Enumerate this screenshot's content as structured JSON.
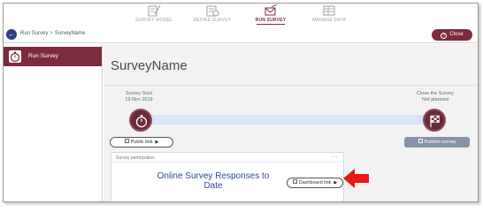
{
  "topnav": {
    "items": [
      {
        "label": "SURVEY MODEL",
        "icon": "edit-form-icon",
        "active": false
      },
      {
        "label": "DEFINE SURVEY",
        "icon": "settings-form-icon",
        "active": false
      },
      {
        "label": "RUN SURVEY",
        "icon": "send-envelope-icon",
        "active": true
      },
      {
        "label": "MANAGE DATA",
        "icon": "data-table-icon",
        "active": false
      }
    ]
  },
  "breadcrumb": {
    "items": [
      "Run Survey",
      "SurveyName"
    ],
    "separator": ">"
  },
  "close_button": {
    "label": "Close"
  },
  "sidebar": {
    "items": [
      {
        "label": "Run Survey",
        "icon": "stopwatch-icon",
        "active": true
      }
    ]
  },
  "main": {
    "title": "SurveyName",
    "survey_start": {
      "label": "Survey Start",
      "date": "19 Nov 2019"
    },
    "survey_close": {
      "label": "Close the Survey",
      "status": "Not planned"
    },
    "public_link_label": "Public link",
    "publish_label": "Publish survey",
    "participation_card": {
      "title": "Survey participation",
      "more": "...",
      "heading": "Online Survey Responses to Date",
      "dashboard_link_label": "Dashboard link"
    }
  },
  "colors": {
    "brand": "#7b2b3b",
    "timeline": "#d7e6f8",
    "publish": "#8793a6",
    "heading": "#2e4a9a",
    "annotation_arrow": "#e8191b"
  }
}
